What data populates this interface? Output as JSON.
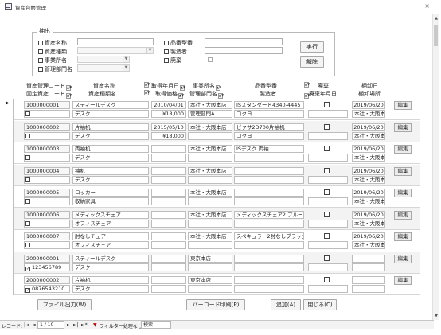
{
  "window": {
    "title": "資産台帳管理",
    "close_glyph": "×"
  },
  "filter": {
    "legend": "抽出",
    "asset_name_label": "資産名称",
    "asset_type_label": "資産種類",
    "office_label": "事業所名",
    "dept_label": "管理部門名",
    "model_label": "品番型番",
    "maker_label": "製造者",
    "disposal_label": "廃棄",
    "run_button": "実行",
    "clear_button": "解除"
  },
  "headers": {
    "row1": [
      "資産管理コード",
      "資産名称",
      "取得年月日",
      "事業所名",
      "品番型番",
      "廃棄",
      "棚卸日"
    ],
    "row2": [
      "固定資産コード",
      "資産種類名",
      "取得価格",
      "管理部門名",
      "製造者",
      "廃棄年月日",
      "棚卸場所"
    ]
  },
  "sort_glyph": "A↓",
  "records": [
    {
      "code": "1000000001",
      "name": "スティールデスク",
      "date": "2010/04/01",
      "office": "本社・大阪本店",
      "model": "ISスタンダード4340-4445",
      "inv_date": "2019/06/20",
      "asset_type": "デスク",
      "price": "¥18,000",
      "dept": "管理部門A",
      "maker": "コクヨ",
      "inv_place": "本社・大阪本",
      "fixed_code": "",
      "fixed_checked": false
    },
    {
      "code": "1000000002",
      "name": "片袖机",
      "date": "2015/05/10",
      "office": "本社・大阪本店",
      "model": "ピクサ2D700片袖机",
      "inv_date": "2019/06/20",
      "asset_type": "デスク",
      "price": "¥18,000",
      "dept": "",
      "maker": "コクヨ",
      "inv_place": "本社・大阪本",
      "fixed_code": "",
      "fixed_checked": false
    },
    {
      "code": "1000000003",
      "name": "両袖机",
      "date": "",
      "office": "本社・大阪本店",
      "model": "ISデスク 両袖",
      "inv_date": "2019/06/20",
      "asset_type": "デスク",
      "price": "",
      "dept": "",
      "maker": "",
      "inv_place": "本社・大阪本",
      "fixed_code": "",
      "fixed_checked": false
    },
    {
      "code": "1000000004",
      "name": "袖机",
      "date": "",
      "office": "本社・大阪本店",
      "model": "",
      "inv_date": "2019/06/20",
      "asset_type": "デスク",
      "price": "",
      "dept": "",
      "maker": "",
      "inv_place": "本社・大阪本",
      "fixed_code": "",
      "fixed_checked": false
    },
    {
      "code": "1000000005",
      "name": "ロッカー",
      "date": "",
      "office": "本社・大阪本店",
      "model": "",
      "inv_date": "2019/06/20",
      "asset_type": "収納家具",
      "price": "",
      "dept": "",
      "maker": "",
      "inv_place": "本社・大阪本",
      "fixed_code": "",
      "fixed_checked": false
    },
    {
      "code": "1000000006",
      "name": "メディックスチェア",
      "date": "",
      "office": "本社・大阪本店",
      "model": "メディックスチェア2 ブルー",
      "inv_date": "2019/06/20",
      "asset_type": "オフィスチェア",
      "price": "",
      "dept": "",
      "maker": "",
      "inv_place": "本社・大阪本",
      "fixed_code": "",
      "fixed_checked": false
    },
    {
      "code": "1000000007",
      "name": "肘なしチェア",
      "date": "",
      "office": "本社・大阪本店",
      "model": "スペキュラー2肘なしブラック",
      "inv_date": "2019/06/20",
      "asset_type": "オフィスチェア",
      "price": "",
      "dept": "",
      "maker": "",
      "inv_place": "本社・大阪本",
      "fixed_code": "",
      "fixed_checked": false
    },
    {
      "code": "2000000001",
      "name": "スティールデスク",
      "date": "",
      "office": "東京本店",
      "model": "",
      "inv_date": "",
      "asset_type": "デスク",
      "price": "",
      "dept": "",
      "maker": "",
      "inv_place": "",
      "fixed_code": "123456789",
      "fixed_checked": true
    },
    {
      "code": "2000000002",
      "name": "片袖机",
      "date": "",
      "office": "東京本店",
      "model": "",
      "inv_date": "",
      "asset_type": "デスク",
      "price": "",
      "dept": "",
      "maker": "",
      "inv_place": "",
      "fixed_code": "0876543210",
      "fixed_checked": true
    }
  ],
  "edit_label": "編集",
  "footer": {
    "file_output": "ファイル出力(W)",
    "barcode_print": "バーコード印刷(P)",
    "add": "追加(A)",
    "close": "閉じる(C)"
  },
  "nav": {
    "record_label": "レコード:",
    "first": "|◄",
    "prev": "◄",
    "position": "1 / 10",
    "next": "►",
    "last": "►|",
    "new": "►*",
    "filter_status": "フィルター処理なし",
    "search": "検索"
  }
}
